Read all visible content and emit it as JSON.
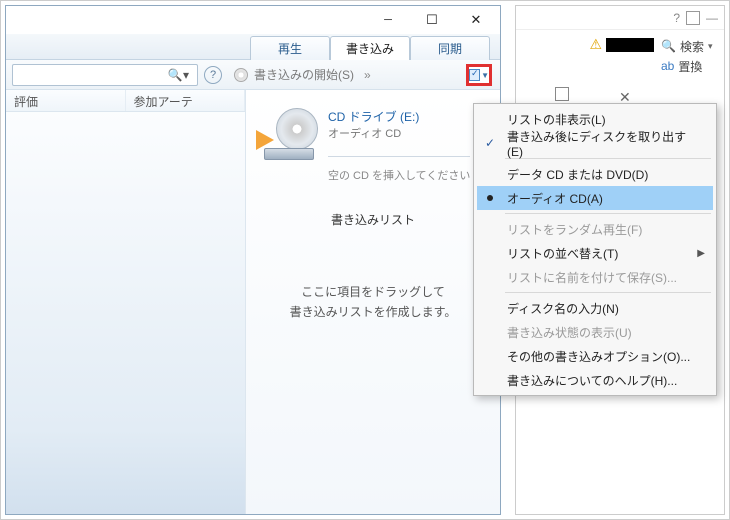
{
  "bg": {
    "search_label": "検索",
    "replace_label": "置換"
  },
  "wmp": {
    "tabs": {
      "play": "再生",
      "burn": "書き込み",
      "sync": "同期"
    },
    "toolbar": {
      "start_burn": "書き込みの開始(S)",
      "chevron": "»"
    },
    "columns": {
      "rating": "評価",
      "artist": "参加アーテ"
    },
    "drive": {
      "title": "CD ドライブ (E:)",
      "subtitle": "オーディオ CD",
      "insert": "空の CD を挿入してください"
    },
    "burn_list_header": "書き込みリスト",
    "drag_hint_1": "ここに項目をドラッグして",
    "drag_hint_2": "書き込みリストを作成します。"
  },
  "menu": {
    "hide_list": "リストの非表示(L)",
    "eject_after": "書き込み後にディスクを取り出す(E)",
    "data_cd": "データ CD または DVD(D)",
    "audio_cd": "オーディオ CD(A)",
    "shuffle": "リストをランダム再生(F)",
    "sort": "リストの並べ替え(T)",
    "save_as": "リストに名前を付けて保存(S)...",
    "disc_name": "ディスク名の入力(N)",
    "show_status": "書き込み状態の表示(U)",
    "more_opts": "その他の書き込みオプション(O)...",
    "help": "書き込みについてのヘルプ(H)..."
  }
}
